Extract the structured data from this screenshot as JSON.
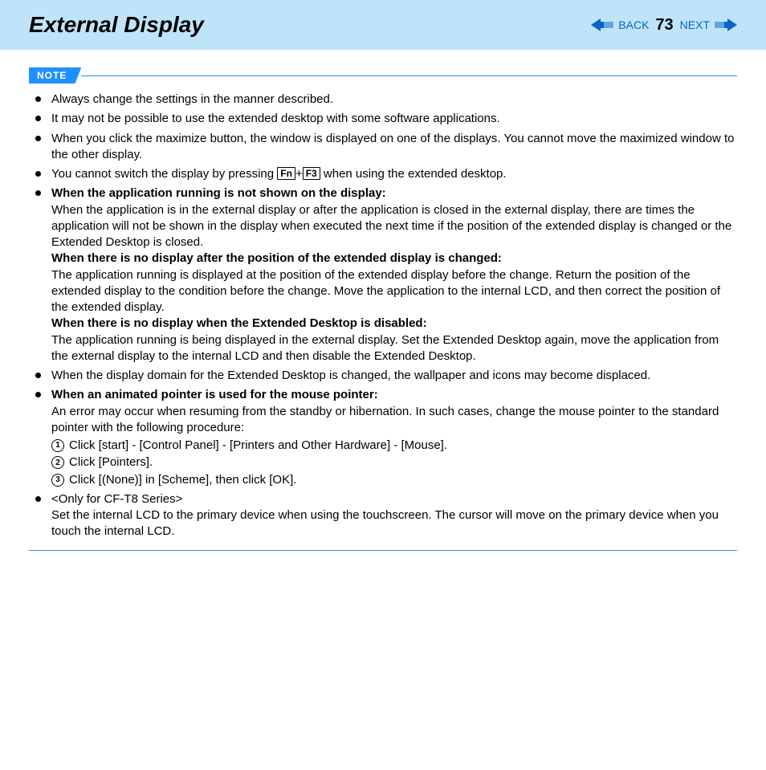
{
  "header": {
    "title": "External Display",
    "back": "BACK",
    "next": "NEXT",
    "page": "73"
  },
  "note": {
    "label": "NOTE"
  },
  "bullets": {
    "b1": "Always change the settings in the manner described.",
    "b2": "It may not be possible to use the extended desktop with some software applications.",
    "b3": "When you click the maximize button, the window is displayed on one of the displays. You cannot move the maximized window to the other display.",
    "b4a": "You cannot switch the display by pressing ",
    "b4key1": "Fn",
    "b4plus": "+",
    "b4key2": "F3",
    "b4b": " when using the extended desktop.",
    "b5h": "When the application running is not shown on the display:",
    "b5p1": "When the application is in the external display or after the application is closed in the external display, there are times the application will not be shown in the display when executed the next time if the position of the extended display is changed or the Extended Desktop is closed.",
    "b5h2": "When there is no display after the position of the extended display is changed:",
    "b5p2": "The application running is displayed at the position of the extended display before the change. Return the position of the extended display to the condition before the change. Move the application to the internal LCD, and then correct the position of the extended display.",
    "b5h3": "When there is no display when the Extended Desktop is disabled:",
    "b5p3": "The application running is being displayed in the external display. Set the Extended Desktop again, move the application from the external display to the internal LCD and then disable the Extended Desktop.",
    "b6": "When the display domain for the Extended Desktop is changed, the wallpaper and icons may become displaced.",
    "b7h": "When an animated pointer is used for the mouse pointer:",
    "b7p": "An error may occur when resuming from the standby or hibernation. In such cases, change the mouse pointer to the standard pointer with the following procedure:",
    "s1": "Click [start] - [Control Panel] - [Printers and Other Hardware] - [Mouse].",
    "s2": "Click [Pointers].",
    "s3": "Click [(None)] in [Scheme], then click [OK].",
    "b8a": "<Only for CF-T8 Series>",
    "b8b": "Set the internal LCD to the primary device when using the touchscreen. The cursor will move on the primary device when you touch the internal LCD."
  },
  "circ": {
    "n1": "1",
    "n2": "2",
    "n3": "3"
  }
}
